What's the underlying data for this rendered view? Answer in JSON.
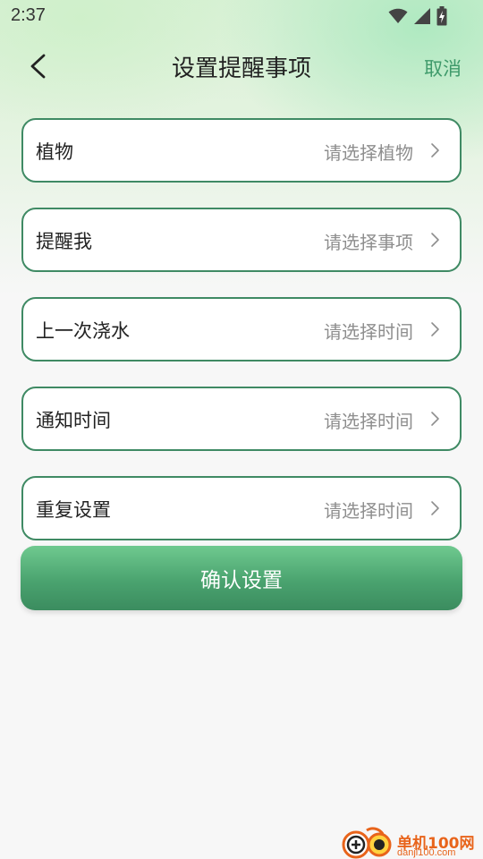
{
  "status_bar": {
    "time": "2:37",
    "icons": [
      "wifi-icon",
      "signal-icon",
      "battery-charging-icon"
    ]
  },
  "nav": {
    "back_icon": "chevron-left-icon",
    "title": "设置提醒事项",
    "cancel_label": "取消"
  },
  "form": {
    "items": [
      {
        "label": "植物",
        "value": "请选择植物"
      },
      {
        "label": "提醒我",
        "value": "请选择事项"
      },
      {
        "label": "上一次浇水",
        "value": "请选择时间"
      },
      {
        "label": "通知时间",
        "value": "请选择时间"
      },
      {
        "label": "重复设置",
        "value": "请选择时间"
      }
    ]
  },
  "confirm": {
    "label": "确认设置"
  },
  "watermark": {
    "cn": "单机100网",
    "en": "danji100.com"
  },
  "colors": {
    "accent": "#3f9a6b",
    "border": "#3f8a64",
    "placeholder": "#8e8e8e",
    "button_top": "#6fc98f",
    "button_bottom": "#3b8c5f"
  }
}
